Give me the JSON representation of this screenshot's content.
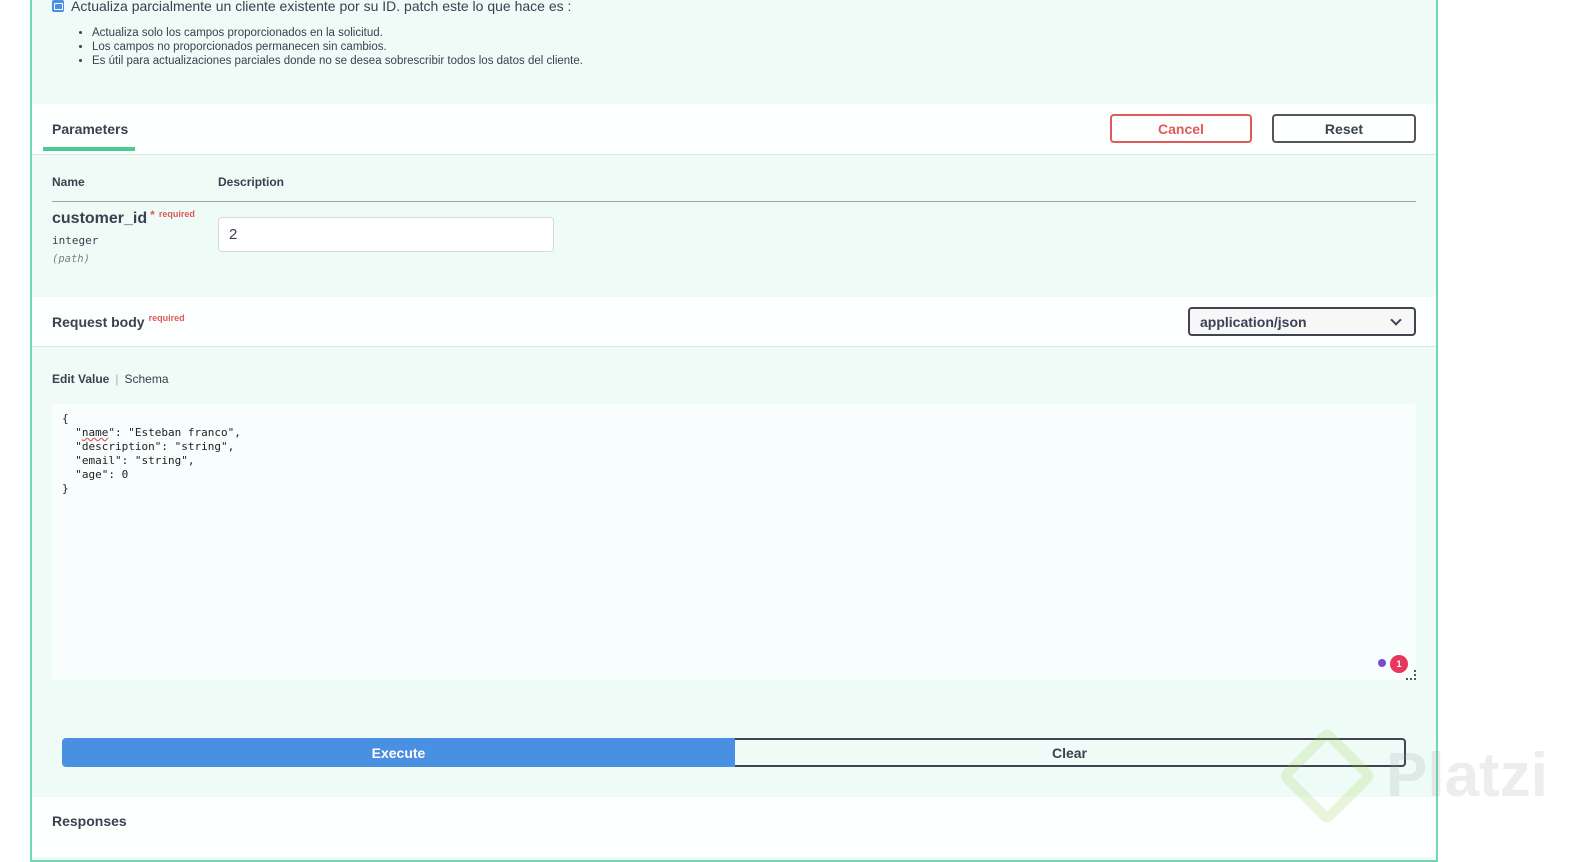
{
  "operation": {
    "summary": "Actualiza parcialmente un cliente existente por su ID. patch este lo que hace es :",
    "bullets": [
      "Actualiza solo los campos proporcionados en la solicitud.",
      "Los campos no proporcionados permanecen sin cambios.",
      "Es útil para actualizaciones parciales donde no se desea sobrescribir todos los datos del cliente."
    ]
  },
  "parameters": {
    "tab_label": "Parameters",
    "cancel_label": "Cancel",
    "reset_label": "Reset",
    "col_name": "Name",
    "col_description": "Description",
    "param": {
      "name": "customer_id",
      "star": "*",
      "required": "required",
      "type": "integer",
      "in": "(path)",
      "value": "2"
    }
  },
  "request_body": {
    "title": "Request body",
    "required": "required",
    "content_type": "application/json",
    "tab_edit": "Edit Value",
    "tab_sep": "|",
    "tab_schema": "Schema",
    "json_lines": [
      "{",
      "  \"name\": \"Esteban franco\",",
      "  \"description\": \"string\",",
      "  \"email\": \"string\",",
      "  \"age\": 0",
      "}"
    ],
    "badge_count": "1"
  },
  "actions": {
    "execute_label": "Execute",
    "clear_label": "Clear"
  },
  "responses": {
    "title": "Responses"
  },
  "watermark": {
    "text": "Platzi"
  },
  "colors": {
    "accent_green": "#49cc90",
    "execute_blue": "#4a90e2",
    "required_red": "#e05a5a"
  }
}
